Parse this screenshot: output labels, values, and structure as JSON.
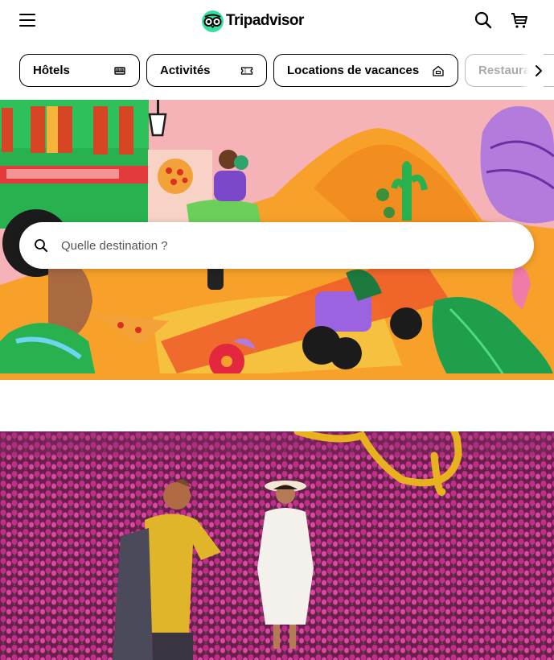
{
  "header": {
    "logo_text": "Tripadvisor",
    "menu_icon": "hamburger-menu-icon",
    "search_icon": "search-icon",
    "cart_icon": "shopping-cart-icon"
  },
  "nav_chips": [
    {
      "label": "Hôtels",
      "icon": "bed-icon"
    },
    {
      "label": "Activités",
      "icon": "ticket-icon"
    },
    {
      "label": "Locations de vacances",
      "icon": "house-icon"
    },
    {
      "label": "Restaura",
      "icon": ""
    }
  ],
  "hero": {
    "search_placeholder": "Quelle destination ?"
  },
  "colors": {
    "brand_green": "#34e0a1",
    "hero_orange": "#f7a12a",
    "hero_pink": "#f5b3b8",
    "tulip_magenta": "#b8247f",
    "banner_yellow": "#e8b21e"
  }
}
